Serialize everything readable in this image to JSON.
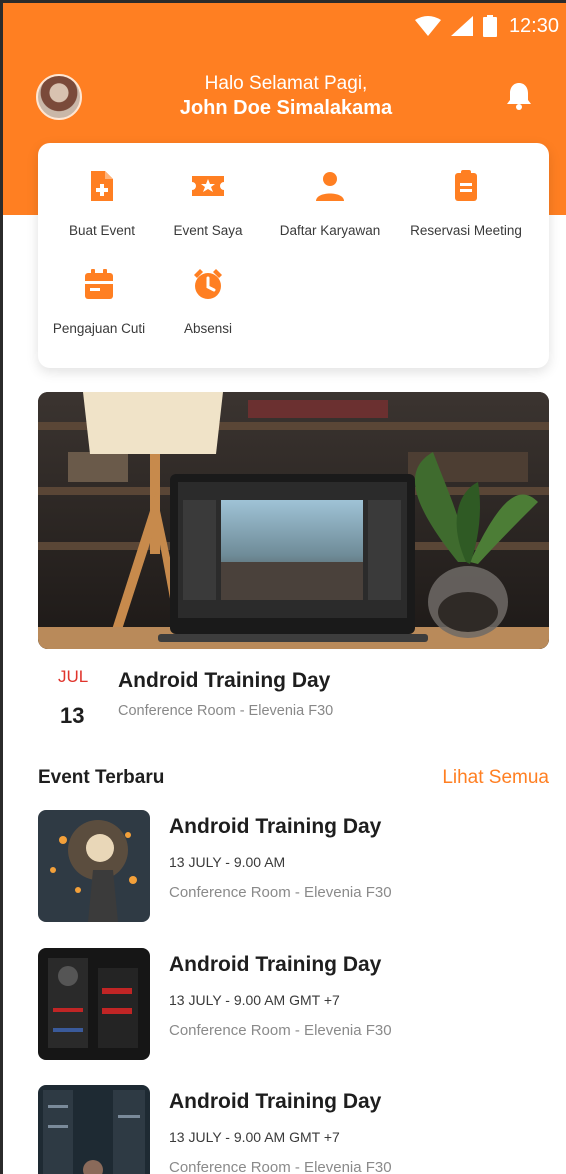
{
  "status_bar": {
    "time": "12:30",
    "icons": [
      "wifi-icon",
      "signal-icon",
      "battery-icon"
    ]
  },
  "header": {
    "greeting": "Halo Selamat Pagi,",
    "user_name": "John Doe Simalakama",
    "accent_color": "#FF7F22"
  },
  "menu": {
    "items": [
      {
        "label": "Buat Event",
        "icon": "add-document-icon"
      },
      {
        "label": "Event Saya",
        "icon": "ticket-icon"
      },
      {
        "label": "Daftar Karyawan",
        "icon": "person-icon"
      },
      {
        "label": "Reservasi Meeting",
        "icon": "clipboard-icon"
      },
      {
        "label": "Pengajuan Cuti",
        "icon": "calendar-icon"
      },
      {
        "label": "Absensi",
        "icon": "alarm-clock-icon"
      }
    ]
  },
  "featured_event": {
    "month": "JUL",
    "day": "13",
    "title": "Android Training Day",
    "location": "Conference Room - Elevenia F30"
  },
  "latest_events": {
    "title": "Event Terbaru",
    "see_all": "Lihat Semua",
    "items": [
      {
        "title": "Android Training Day",
        "date": "13 JULY - 9.00 AM",
        "location": "Conference Room - Elevenia F30"
      },
      {
        "title": "Android Training Day",
        "date": "13 JULY - 9.00 AM GMT +7",
        "location": "Conference Room - Elevenia F30"
      },
      {
        "title": "Android Training Day",
        "date": "13 JULY - 9.00 AM GMT +7",
        "location": "Conference Room - Elevenia F30"
      }
    ]
  }
}
